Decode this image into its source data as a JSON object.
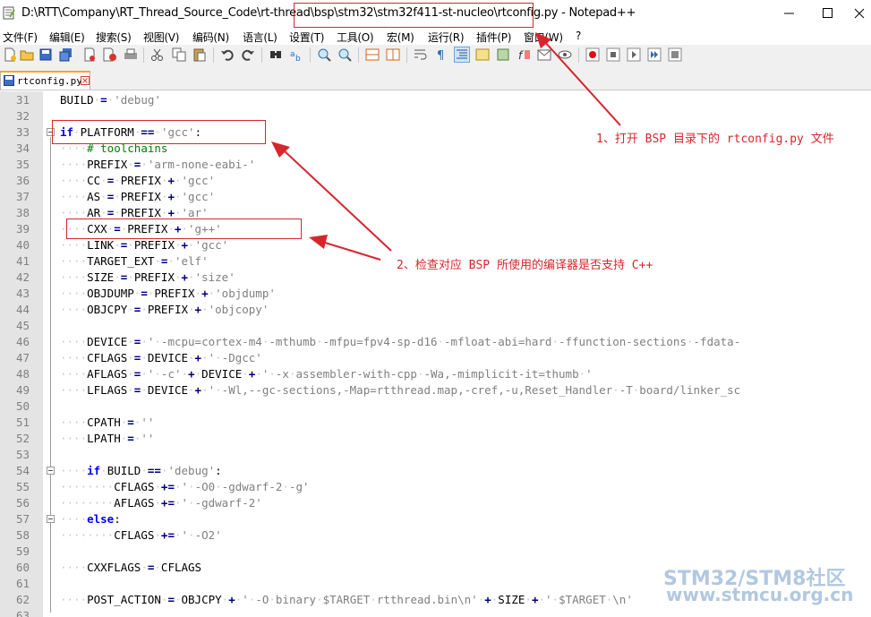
{
  "window": {
    "title": "D:\\RTT\\Company\\RT_Thread_Source_Code\\rt-thread\\bsp\\stm32\\stm32f411-st-nucleo\\rtconfig.py - Notepad++"
  },
  "menu": [
    "文件(F)",
    "编辑(E)",
    "搜索(S)",
    "视图(V)",
    "编码(N)",
    "语言(L)",
    "设置(T)",
    "工具(O)",
    "宏(M)",
    "运行(R)",
    "插件(P)",
    "窗口(W)",
    "?"
  ],
  "tab": {
    "label": "rtconfig.py"
  },
  "editor": {
    "lines": [
      {
        "n": "31",
        "code": "BUILD = 'debug'"
      },
      {
        "n": "32",
        "code": ""
      },
      {
        "n": "33",
        "code": "if PLATFORM == 'gcc':"
      },
      {
        "n": "34",
        "code": "    # toolchains"
      },
      {
        "n": "35",
        "code": "    PREFIX = 'arm-none-eabi-'"
      },
      {
        "n": "36",
        "code": "    CC = PREFIX + 'gcc'"
      },
      {
        "n": "37",
        "code": "    AS = PREFIX + 'gcc'"
      },
      {
        "n": "38",
        "code": "    AR = PREFIX + 'ar'"
      },
      {
        "n": "39",
        "code": "    CXX = PREFIX + 'g++'"
      },
      {
        "n": "40",
        "code": "    LINK = PREFIX + 'gcc'"
      },
      {
        "n": "41",
        "code": "    TARGET_EXT = 'elf'"
      },
      {
        "n": "42",
        "code": "    SIZE = PREFIX + 'size'"
      },
      {
        "n": "43",
        "code": "    OBJDUMP = PREFIX + 'objdump'"
      },
      {
        "n": "44",
        "code": "    OBJCPY = PREFIX + 'objcopy'"
      },
      {
        "n": "45",
        "code": ""
      },
      {
        "n": "46",
        "code": "    DEVICE = ' -mcpu=cortex-m4 -mthumb -mfpu=fpv4-sp-d16 -mfloat-abi=hard -ffunction-sections -fdata-"
      },
      {
        "n": "47",
        "code": "    CFLAGS = DEVICE + ' -Dgcc'"
      },
      {
        "n": "48",
        "code": "    AFLAGS = ' -c' + DEVICE + ' -x assembler-with-cpp -Wa,-mimplicit-it=thumb '"
      },
      {
        "n": "49",
        "code": "    LFLAGS = DEVICE + ' -Wl,--gc-sections,-Map=rtthread.map,-cref,-u,Reset_Handler -T board/linker_sc"
      },
      {
        "n": "50",
        "code": ""
      },
      {
        "n": "51",
        "code": "    CPATH = ''"
      },
      {
        "n": "52",
        "code": "    LPATH = ''"
      },
      {
        "n": "53",
        "code": ""
      },
      {
        "n": "54",
        "code": "    if BUILD == 'debug':"
      },
      {
        "n": "55",
        "code": "        CFLAGS += ' -O0 -gdwarf-2 -g'"
      },
      {
        "n": "56",
        "code": "        AFLAGS += ' -gdwarf-2'"
      },
      {
        "n": "57",
        "code": "    else:"
      },
      {
        "n": "58",
        "code": "        CFLAGS += ' -O2'"
      },
      {
        "n": "59",
        "code": ""
      },
      {
        "n": "60",
        "code": "    CXXFLAGS = CFLAGS"
      },
      {
        "n": "61",
        "code": ""
      },
      {
        "n": "62",
        "code": "    POST_ACTION = OBJCPY + ' -O binary $TARGET rtthread.bin\\n' + SIZE + ' $TARGET \\n'"
      },
      {
        "n": "63",
        "code": ""
      }
    ]
  },
  "annotations": {
    "note1": "1、打开 BSP 目录下的 rtconfig.py 文件",
    "note2": "2、检查对应 BSP 所使用的编译器是否支持 C++"
  },
  "watermark": {
    "line1": "STM32/STM8社区",
    "line2": "www.stmcu.org.cn"
  },
  "colors": {
    "keyword": "#0000ff",
    "string": "#808080",
    "comment": "#008000",
    "operator": "#000080",
    "annotation": "#d6262d",
    "tab_accent": "#f5a623"
  }
}
